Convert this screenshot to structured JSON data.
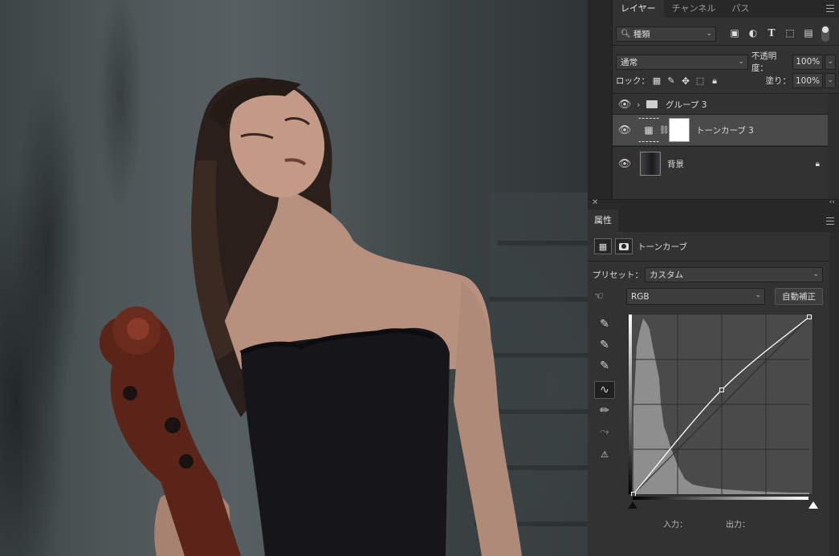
{
  "layers_panel": {
    "tabs": [
      {
        "label": "レイヤー",
        "active": true
      },
      {
        "label": "チャンネル",
        "active": false
      },
      {
        "label": "パス",
        "active": false
      }
    ],
    "filter_kind": "種類",
    "blend_mode": "通常",
    "opacity_label": "不透明度：",
    "opacity_value": "100%",
    "lock_label": "ロック：",
    "fill_label": "塗り：",
    "fill_value": "100%",
    "layers": [
      {
        "name": "グループ 3",
        "type": "group",
        "visible": true,
        "selected": false
      },
      {
        "name": "トーンカーブ 3",
        "type": "adjustment",
        "visible": true,
        "selected": true
      },
      {
        "name": "背景",
        "type": "pixel",
        "visible": true,
        "selected": false,
        "locked": true
      }
    ]
  },
  "properties_panel": {
    "tab_label": "属性",
    "adjustment_name": "トーンカーブ",
    "preset_label": "プリセット：",
    "preset_value": "カスタム",
    "channel_value": "RGB",
    "auto_button_label": "自動補正",
    "input_label": "入力：",
    "output_label": "出力：",
    "curve_points": [
      [
        0,
        0
      ],
      [
        128,
        150
      ],
      [
        255,
        255
      ]
    ]
  },
  "colors": {
    "panel_bg": "#323232",
    "tab_bar_bg": "#282828",
    "selected_layer_bg": "#4a4a4a",
    "histogram": "#909090"
  }
}
